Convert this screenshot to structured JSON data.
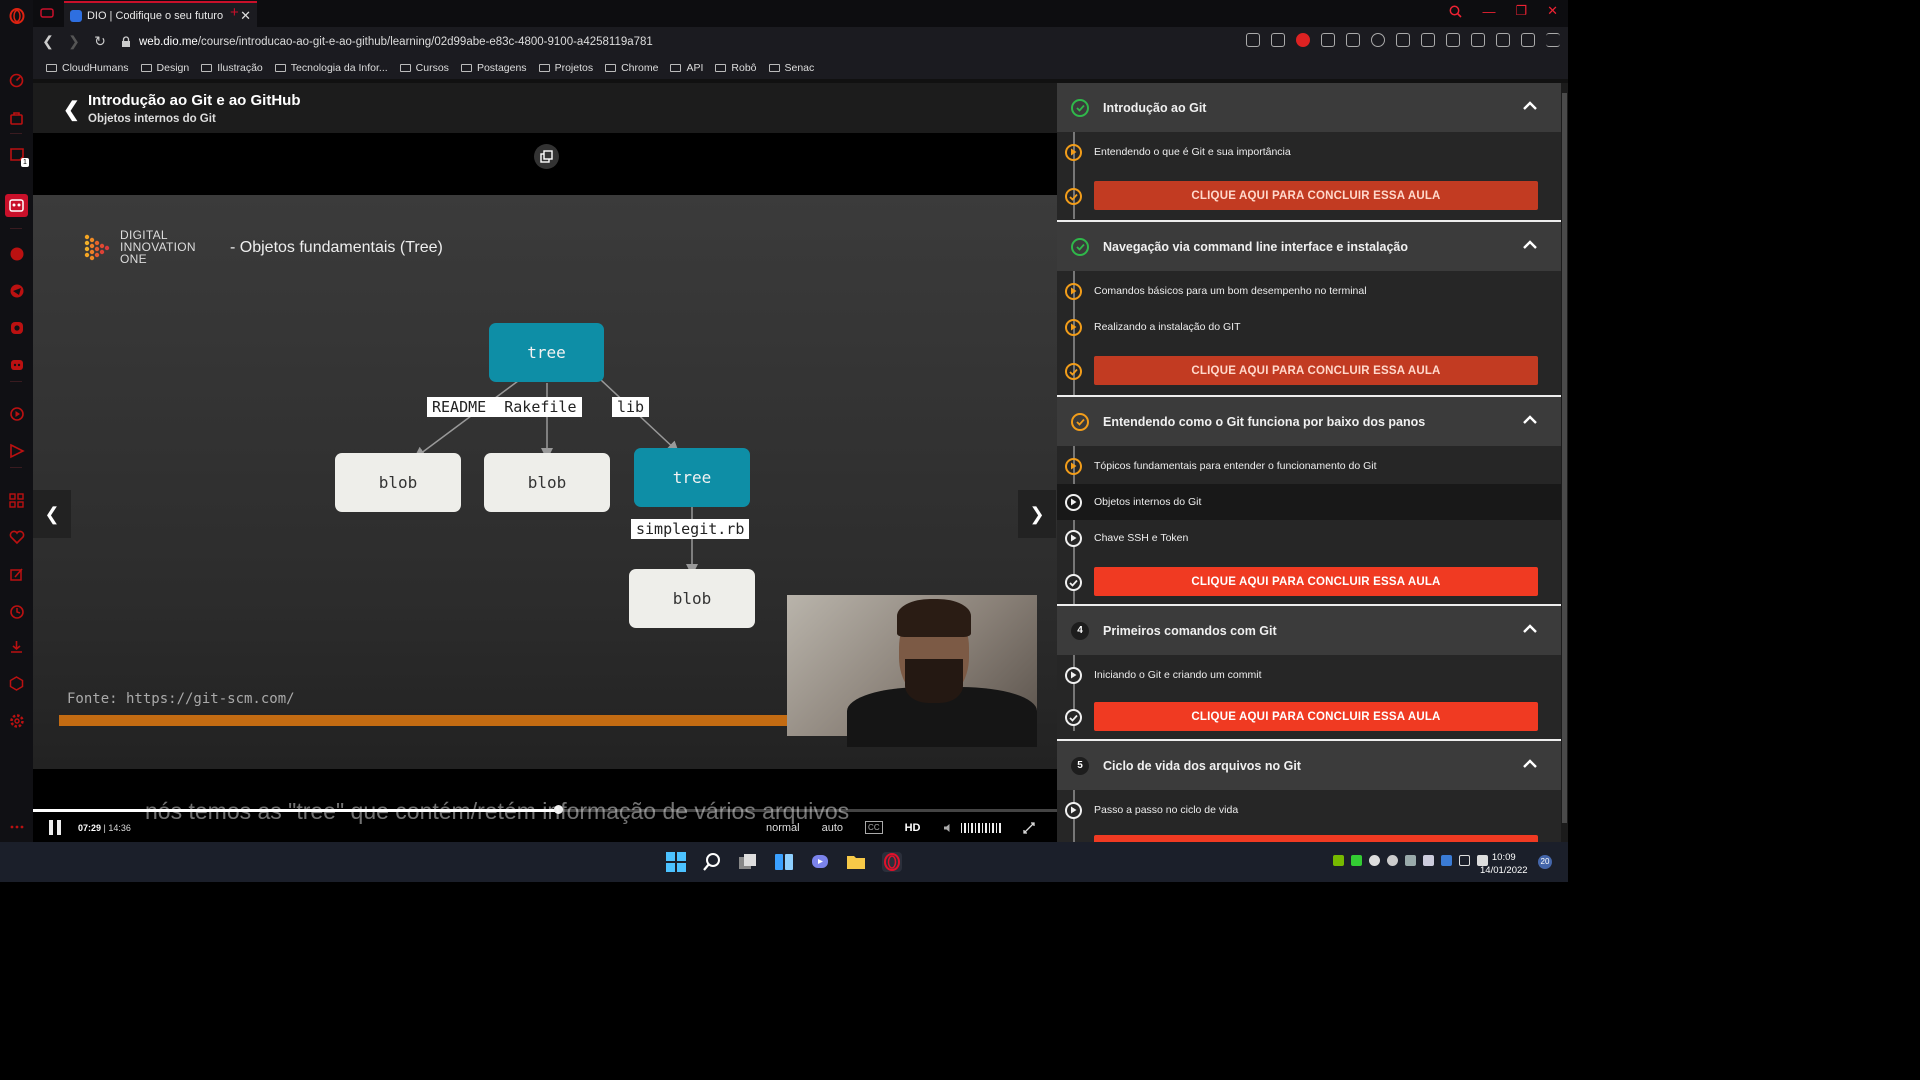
{
  "browser": {
    "tab_title": "DIO | Codifique o seu futuro",
    "url_host": "web.dio.me",
    "url_path": "/course/introducao-ao-git-e-ao-github/learning/02d99abe-e83c-4800-9100-a4258119a781",
    "bookmarks": [
      {
        "label": "CloudHumans"
      },
      {
        "label": "Design"
      },
      {
        "label": "Ilustração"
      },
      {
        "label": "Tecnologia da Infor..."
      },
      {
        "label": "Cursos"
      },
      {
        "label": "Postagens"
      },
      {
        "label": "Projetos"
      },
      {
        "label": "Chrome"
      },
      {
        "label": "API"
      },
      {
        "label": "Robô"
      },
      {
        "label": "Senac"
      }
    ],
    "sidebar_badge": "1"
  },
  "header": {
    "course_title": "Introdução ao Git e ao GitHub",
    "lesson_title": "Objetos internos do Git"
  },
  "slide": {
    "logo_line1": "DIGITAL",
    "logo_line2": "INNOVATION",
    "logo_line3": "ONE",
    "title": "- Objetos fundamentais (Tree)",
    "root_tree": "tree",
    "label_files": "README  Rakefile",
    "label_lib": "lib",
    "blob1": "blob",
    "blob2": "blob",
    "sub_tree": "tree",
    "label_simplegit": "simplegit.rb",
    "blob3": "blob",
    "source": "Fonte: https://git-scm.com/"
  },
  "player": {
    "subtitle": "nós temos as \"tree\" que contém/retém informação  de vários arquivos",
    "current_time": "07:29",
    "time_separator": "|",
    "duration": "14:36",
    "progress_fraction": 0.513,
    "speed": "normal",
    "quality_mode": "auto",
    "cc_label": "CC",
    "hd_label": "HD"
  },
  "panel": {
    "sections": [
      {
        "status": "complete",
        "title": "Introdução ao Git",
        "lessons": [
          {
            "title": "Entendendo o que é Git e sua importância",
            "marker": "orange"
          }
        ],
        "button": "CLIQUE AQUI PARA CONCLUIR ESSA AULA"
      },
      {
        "status": "complete",
        "title": "Navegação via command line interface e instalação",
        "lessons": [
          {
            "title": "Comandos básicos para um bom desempenho no terminal",
            "marker": "orange"
          },
          {
            "title": "Realizando a instalação do GIT",
            "marker": "orange"
          }
        ],
        "button": "CLIQUE AQUI PARA CONCLUIR ESSA AULA"
      },
      {
        "status": "in-progress",
        "title": "Entendendo como o Git funciona por baixo dos panos",
        "lessons": [
          {
            "title": "Tópicos fundamentais para entender o funcionamento do Git",
            "marker": "orange"
          },
          {
            "title": "Objetos internos do Git",
            "marker": "white",
            "active": true
          },
          {
            "title": "Chave SSH e Token",
            "marker": "white"
          }
        ],
        "button": "CLIQUE AQUI PARA CONCLUIR ESSA AULA"
      },
      {
        "number": "4",
        "title": "Primeiros comandos com Git",
        "lessons": [
          {
            "title": "Iniciando o Git e criando um commit",
            "marker": "white"
          }
        ],
        "button": "CLIQUE AQUI PARA CONCLUIR ESSA AULA"
      },
      {
        "number": "5",
        "title": "Ciclo de vida dos arquivos no Git",
        "lessons": [
          {
            "title": "Passo a passo no ciclo de vida",
            "marker": "white"
          }
        ]
      }
    ]
  },
  "taskbar": {
    "time": "10:09",
    "date": "14/01/2022",
    "notifications": "20"
  },
  "colors": {
    "accent": "#c9102a",
    "teal_node": "#0e8ea6",
    "done_green": "#2fb84a",
    "progress_orange": "#f29d1a",
    "button_red": "#f03a22"
  }
}
